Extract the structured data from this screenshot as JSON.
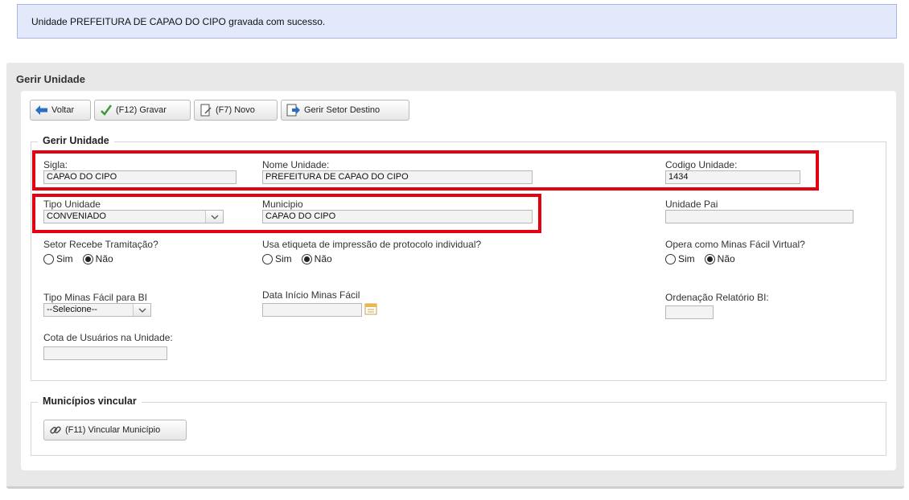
{
  "message": "Unidade PREFEITURA DE CAPAO DO CIPO gravada com sucesso.",
  "panel": {
    "title": "Gerir Unidade"
  },
  "toolbar": {
    "voltar": "Voltar",
    "gravar": "(F12) Gravar",
    "novo": "(F7) Novo",
    "gerir_setor": "Gerir Setor Destino"
  },
  "form": {
    "legend": "Gerir Unidade",
    "sigla": {
      "label": "Sigla:",
      "value": "CAPAO DO CIPO"
    },
    "nome": {
      "label": "Nome Unidade:",
      "value": "PREFEITURA DE CAPAO DO CIPO"
    },
    "codigo": {
      "label": "Codigo Unidade:",
      "value": "1434"
    },
    "tipo": {
      "label": "Tipo Unidade",
      "value": "CONVENIADO"
    },
    "municipio": {
      "label": "Municipio",
      "value": "CAPAO DO CIPO"
    },
    "unidade_pai": {
      "label": "Unidade Pai",
      "value": ""
    },
    "setor_recebe": {
      "label": "Setor Recebe Tramitação?",
      "options": [
        "Sim",
        "Não"
      ],
      "selected": "Não"
    },
    "etiqueta": {
      "label": "Usa etiqueta de impressão de protocolo individual?",
      "options": [
        "Sim",
        "Não"
      ],
      "selected": "Não"
    },
    "minas_virtual": {
      "label": "Opera como Minas Fácil Virtual?",
      "options": [
        "Sim",
        "Não"
      ],
      "selected": "Não"
    },
    "tipo_minas": {
      "label": "Tipo Minas Fácil para BI",
      "value": "--Selecione--"
    },
    "data_inicio": {
      "label": "Data Início Minas Fácil",
      "value": ""
    },
    "ordenacao": {
      "label": "Ordenação Relatório BI:",
      "value": ""
    },
    "cota": {
      "label": "Cota de Usuários na Unidade:",
      "value": ""
    }
  },
  "municipios": {
    "legend": "Municípios vincular",
    "button": "(F11) Vincular Município"
  },
  "colors": {
    "highlight": "#e3000f",
    "message_bg": "#e3e9fb",
    "panel_bg": "#e8e8e8"
  }
}
